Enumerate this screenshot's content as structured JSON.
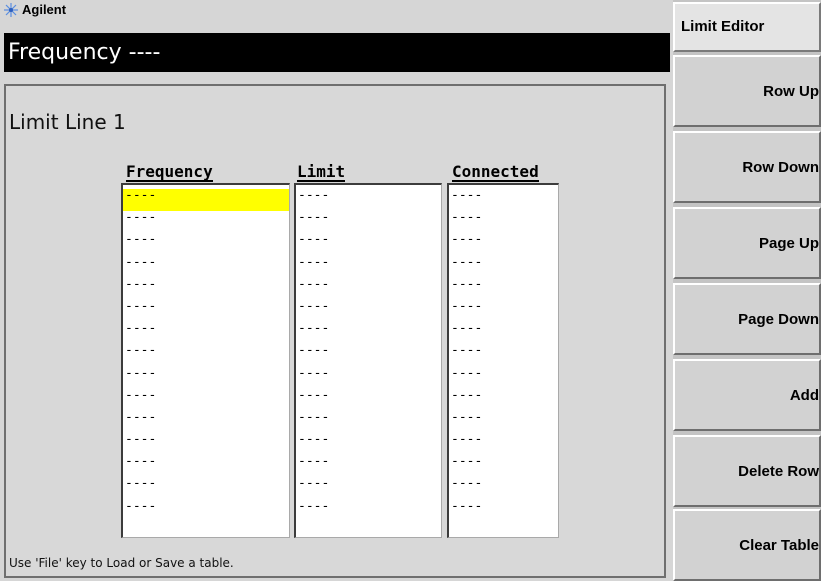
{
  "brand": {
    "name": "Agilent",
    "icon": "starburst-logo-icon"
  },
  "header": {
    "title": "Frequency ----"
  },
  "limit": {
    "title": "Limit Line 1",
    "columns": [
      {
        "header": "Frequency",
        "values": [
          "----",
          "----",
          "----",
          "----",
          "----",
          "----",
          "----",
          "----",
          "----",
          "----",
          "----",
          "----",
          "----",
          "----",
          "----"
        ]
      },
      {
        "header": "Limit",
        "values": [
          "----",
          "----",
          "----",
          "----",
          "----",
          "----",
          "----",
          "----",
          "----",
          "----",
          "----",
          "----",
          "----",
          "----",
          "----"
        ]
      },
      {
        "header": "Connected",
        "values": [
          "----",
          "----",
          "----",
          "----",
          "----",
          "----",
          "----",
          "----",
          "----",
          "----",
          "----",
          "----",
          "----",
          "----",
          "----"
        ]
      }
    ],
    "selected_row": 0,
    "selected_column": 0
  },
  "status": {
    "text": "Use 'File' key to Load or Save a table."
  },
  "softkeys": {
    "header": "Limit Editor",
    "buttons": [
      "Row Up",
      "Row Down",
      "Page Up",
      "Page Down",
      "Add",
      "Delete Row",
      "Clear Table"
    ]
  },
  "colors": {
    "selection": "#ffff00",
    "title_bar": "#000000",
    "background": "#d6d6d6"
  }
}
